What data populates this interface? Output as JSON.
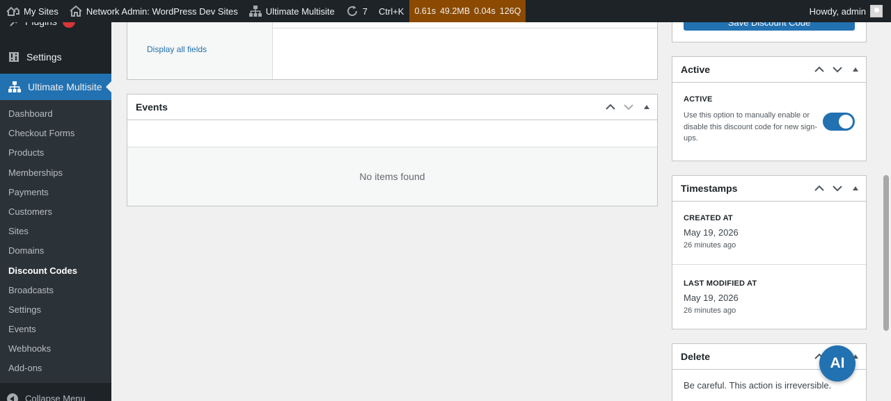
{
  "adminbar": {
    "my_sites": "My Sites",
    "network_admin": "Network Admin: WordPress Dev Sites",
    "ultimate_multisite": "Ultimate Multisite",
    "updates_count": "7",
    "shortcut": "Ctrl+K",
    "qm_time": "0.61s",
    "qm_memory": "49.2MB",
    "qm_db_time": "0.04s",
    "qm_queries": "126Q",
    "howdy": "Howdy, admin"
  },
  "sidebar": {
    "partial_item": "Plugins",
    "settings": "Settings",
    "current": "Ultimate Multisite",
    "submenu": [
      "Dashboard",
      "Checkout Forms",
      "Products",
      "Memberships",
      "Payments",
      "Customers",
      "Sites",
      "Domains",
      "Discount Codes",
      "Broadcasts",
      "Settings",
      "Events",
      "Webhooks",
      "Add-ons"
    ],
    "active_submenu": "Discount Codes",
    "collapse": "Collapse Menu"
  },
  "main": {
    "display_all_fields": "Display all fields",
    "events_title": "Events",
    "events_empty": "No items found"
  },
  "side": {
    "save_button": "Save Discount Code",
    "active_box": {
      "title": "Active",
      "label": "ACTIVE",
      "description": "Use this option to manually enable or disable this discount code for new sign-ups.",
      "toggle_on": true
    },
    "timestamps": {
      "title": "Timestamps",
      "created_label": "CREATED AT",
      "created_date": "May 19, 2026",
      "created_ago": "26 minutes ago",
      "modified_label": "LAST MODIFIED AT",
      "modified_date": "May 19, 2026",
      "modified_ago": "26 minutes ago"
    },
    "delete": {
      "title": "Delete",
      "warning": "Be careful. This action is irreversible."
    }
  },
  "fab_label": "AI",
  "colors": {
    "primary": "#2271b1",
    "adminbar": "#1d2327",
    "qm": "#8b4a00",
    "badge": "#d63638"
  }
}
